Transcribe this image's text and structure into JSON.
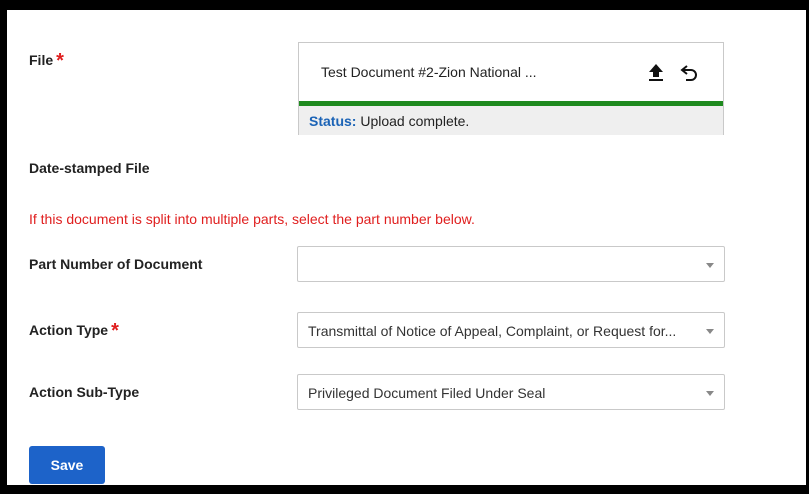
{
  "file": {
    "label": "File",
    "required_mark": "*",
    "file_name": "Test Document #2-Zion National ...",
    "status_label": "Status:",
    "status_text": "Upload complete.",
    "icons": [
      "upload-icon",
      "undo-icon"
    ]
  },
  "date_stamped": {
    "label": "Date-stamped File"
  },
  "notice": "If this document is split into multiple parts, select the part number below.",
  "part_number": {
    "label": "Part Number of Document",
    "value": ""
  },
  "action_type": {
    "label": "Action Type",
    "required_mark": "*",
    "value": "Transmittal of Notice of Appeal, Complaint, or Request for..."
  },
  "action_sub_type": {
    "label": "Action Sub-Type",
    "value": "Privileged Document Filed Under Seal"
  },
  "save_label": "Save",
  "colors": {
    "required": "#e01e1e",
    "accent": "#1d63c9",
    "status_label": "#1b63b6",
    "success_bar": "#1f8a1f"
  }
}
